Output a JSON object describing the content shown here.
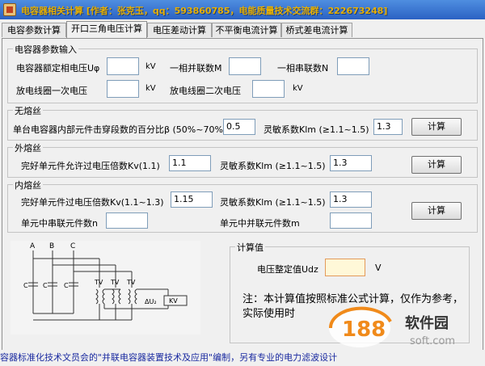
{
  "window": {
    "title": "电容器相关计算 [作者：张克玉，qq：593860785，电能质量技术交流群：222673248]"
  },
  "tabs": [
    {
      "label": "电容参数计算"
    },
    {
      "label": "开口三角电压计算"
    },
    {
      "label": "电压差动计算"
    },
    {
      "label": "不平衡电流计算"
    },
    {
      "label": "桥式差电流计算"
    }
  ],
  "params": {
    "title": "电容器参数输入",
    "rated_voltage_label": "电容器额定相电压Uφ",
    "rated_voltage_value": "",
    "rated_voltage_unit": "kV",
    "parallel_label": "一相并联数M",
    "parallel_value": "",
    "series_label": "一相串联数N",
    "series_value": "",
    "coil_primary_label": "放电线圈一次电压",
    "coil_primary_value": "",
    "coil_primary_unit": "kV",
    "coil_secondary_label": "放电线圈二次电压",
    "coil_secondary_value": "",
    "coil_secondary_unit": "kV"
  },
  "no_fuse": {
    "title": "无熔丝",
    "percent_label": "单台电容器内部元件击穿段数的百分比β (50%~70%)",
    "percent_value": "0.5",
    "sens_label": "灵敏系数Klm (≥1.1~1.5)",
    "sens_value": "1.3",
    "calc_button": "计算"
  },
  "ext_fuse": {
    "title": "外熔丝",
    "kv_label": "完好单元件允许过电压倍数Kv(1.1)",
    "kv_value": "1.1",
    "sens_label": "灵敏系数Klm (≥1.1~1.5)",
    "sens_value": "1.3",
    "calc_button": "计算"
  },
  "int_fuse": {
    "title": "内熔丝",
    "kv_label": "完好单元件过电压倍数Kv(1.1~1.3)",
    "kv_value": "1.15",
    "sens_label": "灵敏系数Klm (≥1.1~1.5)",
    "sens_value": "1.3",
    "n_label": "单元中串联元件数n",
    "n_value": "",
    "m_label": "单元中并联元件数m",
    "m_value": "",
    "calc_button": "计算"
  },
  "diagram": {
    "phase_a": "A",
    "phase_b": "B",
    "phase_c": "C",
    "cap": "C",
    "tv": "TV",
    "delta_u": "ΔU₂",
    "kv": "KV"
  },
  "result": {
    "title": "计算值",
    "voltage_label": "电压整定值Udz",
    "voltage_value": "",
    "voltage_unit": "V",
    "note": "注：本计算值按照标准公式计算，仅作为参考，实际使用时"
  },
  "footer": {
    "text": "容器标准化技术文员会的\"并联电容器装置技术及应用\"编制，另有专业的电力滤波设计"
  },
  "watermark": {
    "number": "188",
    "name": "软件园",
    "domain": "soft.com"
  },
  "colors": {
    "title_text": "#e8b000",
    "titlebar": "#2b62c3",
    "input_highlight": "#fff8d8"
  }
}
